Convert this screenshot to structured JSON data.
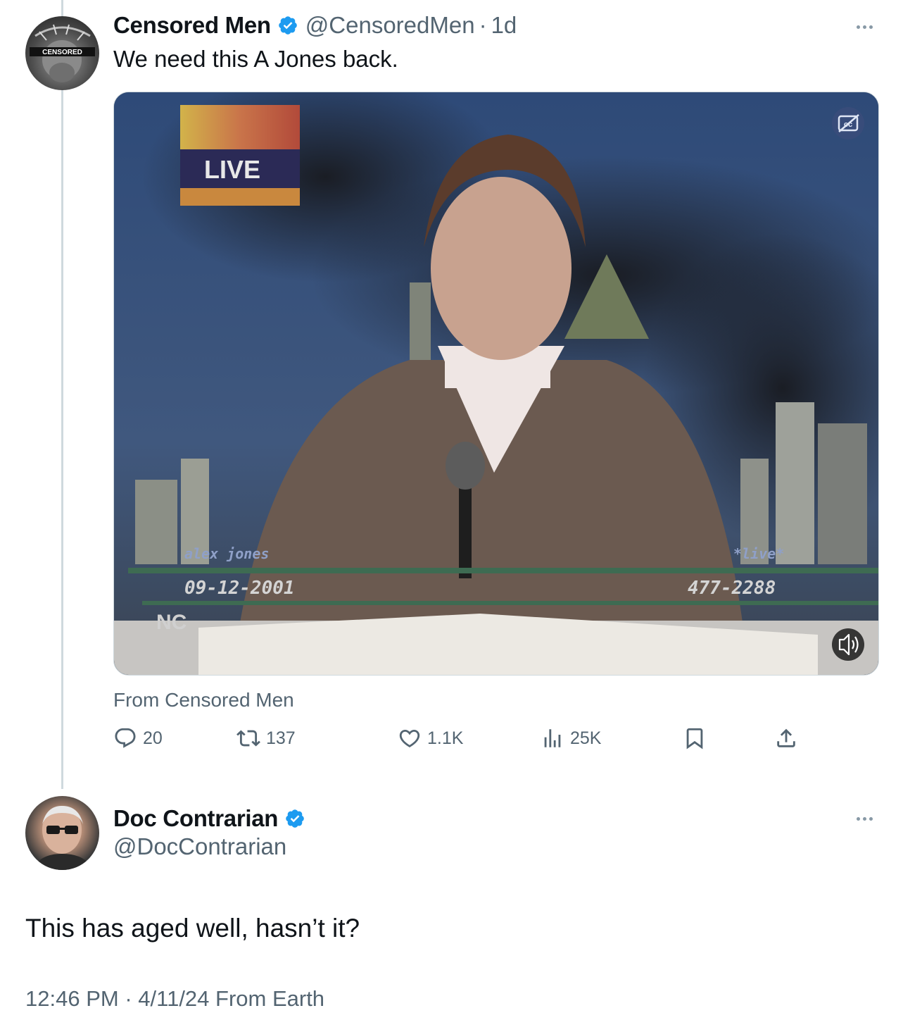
{
  "tweet": {
    "display_name": "Censored Men",
    "handle": "@CensoredMen",
    "separator": "·",
    "time": "1d",
    "text": "We need this A Jones back.",
    "avatar_label": "CENSORED",
    "media": {
      "overlay_live": "LIVE",
      "lower_third_name": "alex jones",
      "lower_third_date": "09-12-2001",
      "lower_third_live": "*live*",
      "lower_third_phone": "477-2288",
      "corner_text": "NC",
      "caption_icon": "cc-off-icon",
      "sound_icon": "speaker-icon"
    },
    "attribution": "From Censored Men",
    "stats": {
      "replies": "20",
      "reposts": "137",
      "likes": "1.1K",
      "views": "25K"
    }
  },
  "reply": {
    "display_name": "Doc Contrarian",
    "handle": "@DocContrarian",
    "text": "This has aged well, hasn’t it?",
    "time": "12:46 PM",
    "separator": "·",
    "date_source": "4/11/24 From Earth"
  },
  "colors": {
    "verified": "#1d9bf0",
    "secondary_text": "#536471",
    "thread_line": "#cfd9de"
  }
}
